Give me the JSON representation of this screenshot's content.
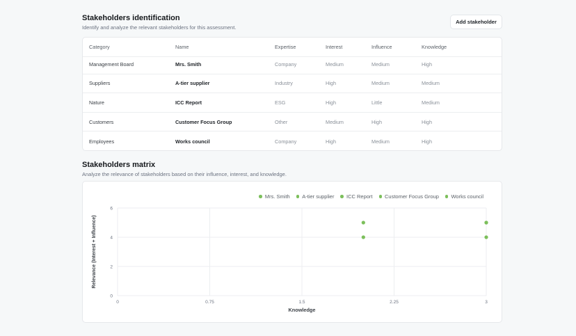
{
  "identification": {
    "title": "Stakeholders identification",
    "subtitle": "Identify and analyze the relevant stakeholders for this assessment.",
    "add_button": "Add stakeholder"
  },
  "table": {
    "headers": [
      "Category",
      "Name",
      "Expertise",
      "Interest",
      "Influence",
      "Knowledge"
    ],
    "rows": [
      [
        "Management Board",
        "Mrs. Smith",
        "Company",
        "Medium",
        "Medium",
        "High"
      ],
      [
        "Suppliers",
        "A-tier supplier",
        "Industry",
        "High",
        "Medium",
        "Medium"
      ],
      [
        "Nature",
        "ICC Report",
        "ESG",
        "High",
        "Little",
        "Medium"
      ],
      [
        "Customers",
        "Customer Focus Group",
        "Other",
        "Medium",
        "High",
        "High"
      ],
      [
        "Employees",
        "Works council",
        "Company",
        "High",
        "Medium",
        "High"
      ]
    ]
  },
  "matrix": {
    "title": "Stakeholders matrix",
    "subtitle": "Analyze the relevance of stakeholders based on their influence, interest, and knowledge."
  },
  "chart_data": {
    "type": "scatter",
    "xlabel": "Knowledge",
    "ylabel": "Relevance (Interest + Influence)",
    "xlim": [
      0,
      3
    ],
    "ylim": [
      0,
      6
    ],
    "x_ticks": [
      "0",
      "0.75",
      "1.5",
      "2.25",
      "3"
    ],
    "y_ticks": [
      "0",
      "2",
      "4",
      "6"
    ],
    "grid": true,
    "legend_position": "top-right",
    "marker_color": "#7cbf5b",
    "series": [
      {
        "name": "Mrs. Smith",
        "points": [
          [
            3,
            4
          ]
        ]
      },
      {
        "name": "A-tier supplier",
        "points": [
          [
            2,
            5
          ]
        ]
      },
      {
        "name": "ICC Report",
        "points": [
          [
            2,
            4
          ]
        ]
      },
      {
        "name": "Customer Focus Group",
        "points": [
          [
            3,
            5
          ]
        ]
      },
      {
        "name": "Works council",
        "points": [
          [
            3,
            5
          ]
        ]
      }
    ]
  }
}
